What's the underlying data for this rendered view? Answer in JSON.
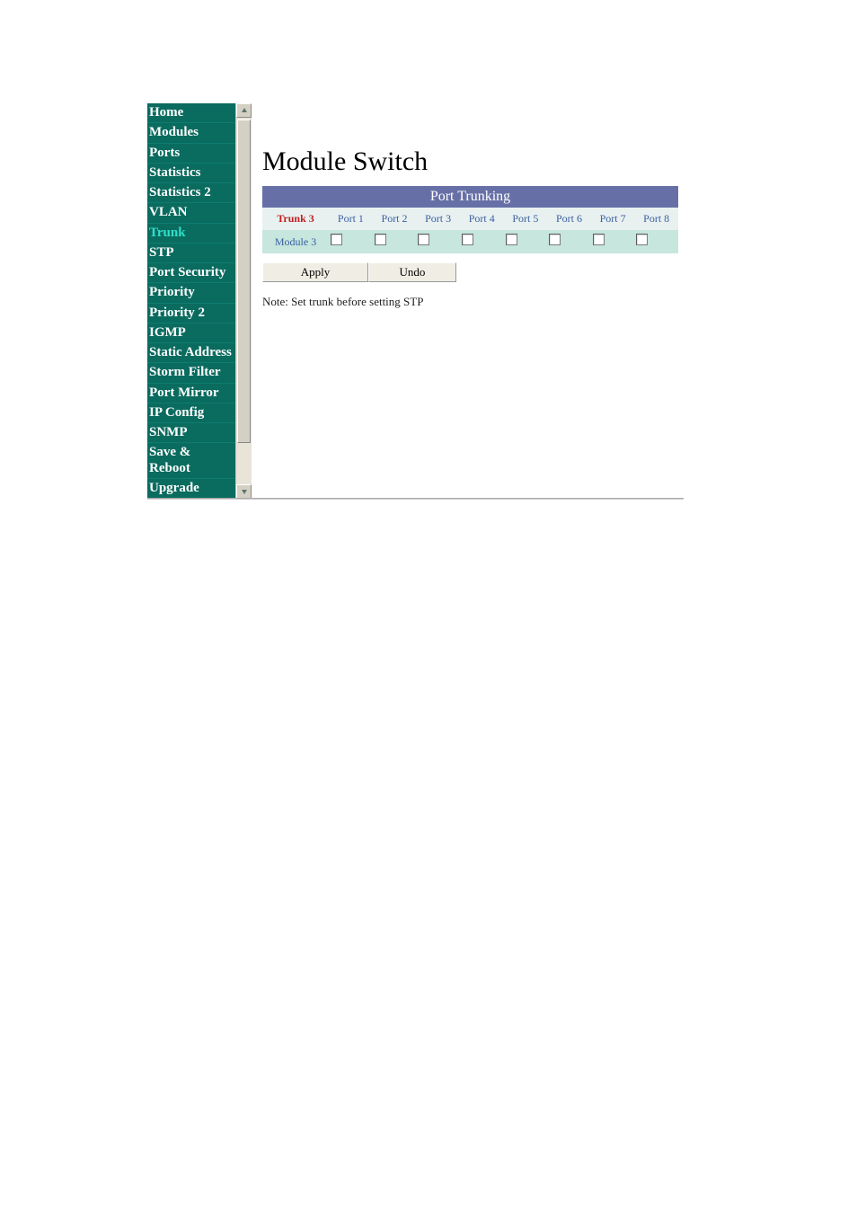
{
  "sidebar": {
    "items": [
      {
        "label": "Home",
        "active": false
      },
      {
        "label": "Modules",
        "active": false
      },
      {
        "label": "Ports",
        "active": false
      },
      {
        "label": "Statistics",
        "active": false
      },
      {
        "label": "Statistics 2",
        "active": false
      },
      {
        "label": "VLAN",
        "active": false
      },
      {
        "label": "Trunk",
        "active": true
      },
      {
        "label": "STP",
        "active": false
      },
      {
        "label": "Port Security",
        "active": false
      },
      {
        "label": "Priority",
        "active": false
      },
      {
        "label": "Priority 2",
        "active": false
      },
      {
        "label": "IGMP",
        "active": false
      },
      {
        "label": "Static Address",
        "active": false
      },
      {
        "label": "Storm Filter",
        "active": false
      },
      {
        "label": "Port Mirror",
        "active": false
      },
      {
        "label": "IP Config",
        "active": false
      },
      {
        "label": "SNMP",
        "active": false
      },
      {
        "label": "Save & Reboot",
        "active": false
      },
      {
        "label": "Upgrade",
        "active": false
      }
    ]
  },
  "main": {
    "title": "Module Switch",
    "table_header": "Port Trunking",
    "trunk_label": "Trunk 3",
    "port_headers": [
      "Port 1",
      "Port 2",
      "Port 3",
      "Port 4",
      "Port 5",
      "Port 6",
      "Port 7",
      "Port 8"
    ],
    "row_label": "Module 3",
    "port_checks": [
      false,
      false,
      false,
      false,
      false,
      false,
      false,
      false
    ],
    "apply_label": "Apply",
    "undo_label": "Undo",
    "note": "Note: Set trunk before setting STP"
  }
}
